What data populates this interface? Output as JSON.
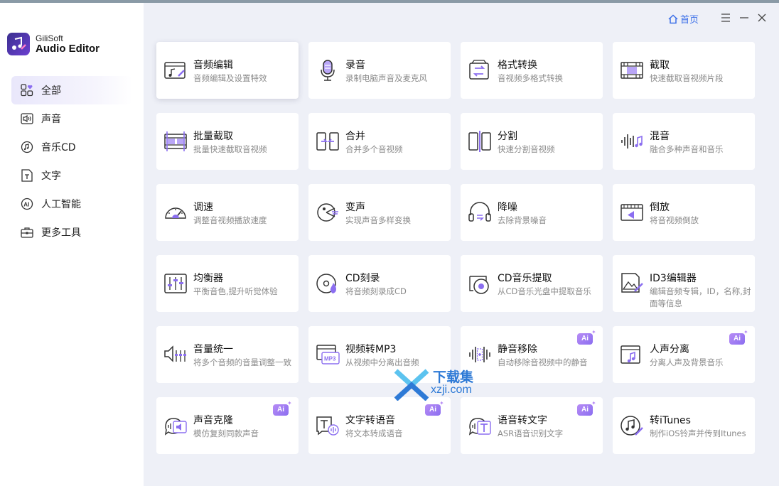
{
  "app": {
    "brand_line1": "GiliSoft",
    "brand_line2": "Audio Editor"
  },
  "header": {
    "home_label": "首页"
  },
  "sidebar": {
    "items": [
      {
        "label": "全部",
        "icon": "grid-heart-icon",
        "active": true
      },
      {
        "label": "声音",
        "icon": "speaker-icon",
        "active": false
      },
      {
        "label": "音乐CD",
        "icon": "music-cd-icon",
        "active": false
      },
      {
        "label": "文字",
        "icon": "text-icon",
        "active": false
      },
      {
        "label": "人工智能",
        "icon": "ai-icon",
        "active": false
      },
      {
        "label": "更多工具",
        "icon": "toolbox-icon",
        "active": false
      }
    ]
  },
  "tools": [
    {
      "title": "音频编辑",
      "desc": "音频编辑及设置特效",
      "icon": "audio-edit-icon",
      "ai": false
    },
    {
      "title": "录音",
      "desc": "录制电脑声音及麦克风",
      "icon": "microphone-icon",
      "ai": false
    },
    {
      "title": "格式转换",
      "desc": "音视频多格式转换",
      "icon": "format-convert-icon",
      "ai": false
    },
    {
      "title": "截取",
      "desc": "快速截取音视频片段",
      "icon": "trim-icon",
      "ai": false
    },
    {
      "title": "批量截取",
      "desc": "批量快速截取音视频",
      "icon": "batch-trim-icon",
      "ai": false
    },
    {
      "title": "合并",
      "desc": "合并多个音视频",
      "icon": "merge-icon",
      "ai": false
    },
    {
      "title": "分割",
      "desc": "快速分割音视频",
      "icon": "split-icon",
      "ai": false
    },
    {
      "title": "混音",
      "desc": "融合多种声音和音乐",
      "icon": "mix-icon",
      "ai": false
    },
    {
      "title": "调速",
      "desc": "调整音视频播放速度",
      "icon": "speed-icon",
      "ai": false
    },
    {
      "title": "变声",
      "desc": "实现声音多样变换",
      "icon": "voice-changer-icon",
      "ai": false
    },
    {
      "title": "降噪",
      "desc": "去除背景噪音",
      "icon": "denoise-icon",
      "ai": false
    },
    {
      "title": "倒放",
      "desc": "将音视频倒放",
      "icon": "reverse-icon",
      "ai": false
    },
    {
      "title": "均衡器",
      "desc": "平衡音色,提升听觉体验",
      "icon": "equalizer-icon",
      "ai": false
    },
    {
      "title": "CD刻录",
      "desc": "将音频刻录成CD",
      "icon": "cd-burn-icon",
      "ai": false
    },
    {
      "title": "CD音乐提取",
      "desc": "从CD音乐光盘中提取音乐",
      "icon": "cd-rip-icon",
      "ai": false
    },
    {
      "title": "ID3编辑器",
      "desc": "编辑音频专辑，ID，名称,封面等信息",
      "icon": "id3-editor-icon",
      "ai": false
    },
    {
      "title": "音量统一",
      "desc": "将多个音频的音量调整一致",
      "icon": "volume-normalize-icon",
      "ai": false
    },
    {
      "title": "视频转MP3",
      "desc": "从视频中分离出音频",
      "icon": "video-to-mp3-icon",
      "ai": false
    },
    {
      "title": "静音移除",
      "desc": "自动移除音视频中的静音",
      "icon": "silence-remove-icon",
      "ai": true
    },
    {
      "title": "人声分离",
      "desc": "分离人声及背景音乐",
      "icon": "vocal-separate-icon",
      "ai": true
    },
    {
      "title": "声音克隆",
      "desc": "模仿复刻同款声音",
      "icon": "voice-clone-icon",
      "ai": true
    },
    {
      "title": "文字转语音",
      "desc": "将文本转成语音",
      "icon": "text-to-speech-icon",
      "ai": true
    },
    {
      "title": "语音转文字",
      "desc": "ASR语音识别文字",
      "icon": "speech-to-text-icon",
      "ai": true
    },
    {
      "title": "转iTunes",
      "desc": "制作iOS铃声并传到Itunes",
      "icon": "itunes-icon",
      "ai": false
    }
  ],
  "ai_badge_label": "Ai",
  "watermark": {
    "line1": "下载集",
    "line2": "xzji.com"
  },
  "colors": {
    "accent": "#7b5cf0",
    "link": "#3a6ee8",
    "background": "#eef0f7"
  }
}
